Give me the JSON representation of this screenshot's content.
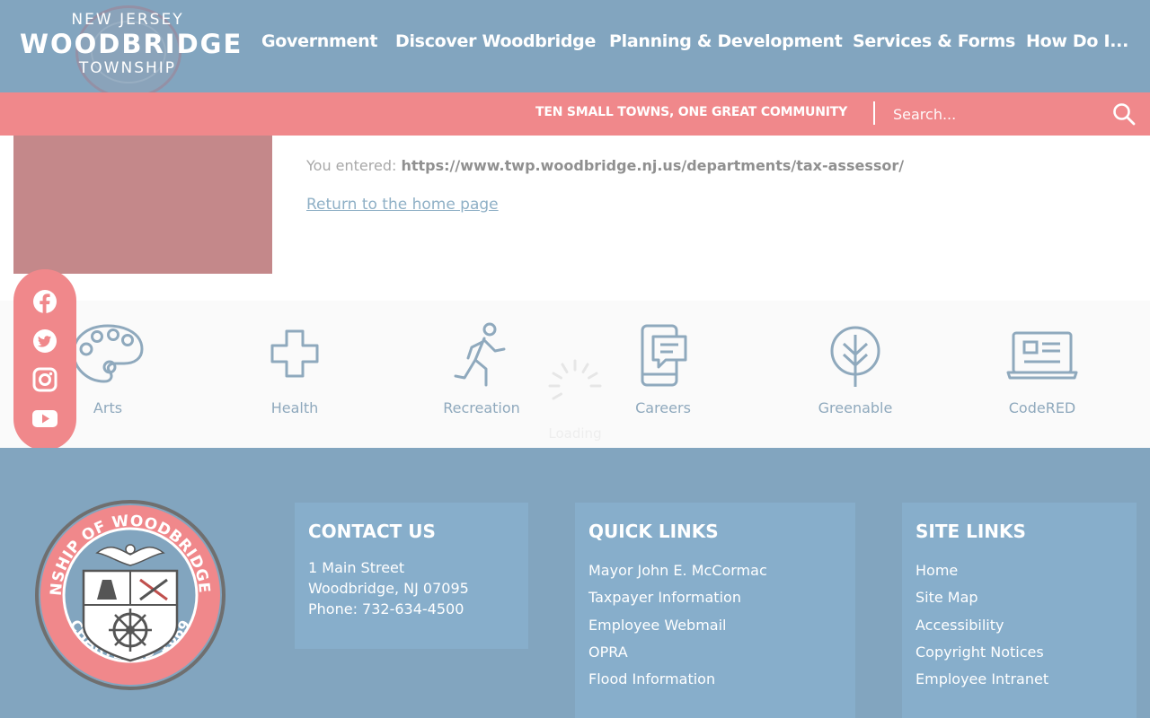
{
  "header": {
    "logo_top": "NEW JERSEY",
    "logo_main": "WOODBRIDGE",
    "logo_bottom": "TOWNSHIP",
    "nav": [
      {
        "label": "Government"
      },
      {
        "label": "Discover Woodbridge"
      },
      {
        "label": "Planning & Development"
      },
      {
        "label": "Services & Forms"
      },
      {
        "label": "How Do I..."
      }
    ]
  },
  "banner": {
    "tagline": "TEN SMALL TOWNS, ONE GREAT COMMUNITY",
    "search_placeholder": "Search...",
    "search_icon": "search-icon"
  },
  "content": {
    "entered_prefix": "You entered:",
    "entered_url": "https://www.twp.woodbridge.nj.us/departments/tax-assessor/",
    "return_link": "Return to the home page"
  },
  "icon_strip": {
    "items": [
      {
        "label": "Arts",
        "icon": "palette-icon"
      },
      {
        "label": "Health",
        "icon": "cross-icon"
      },
      {
        "label": "Recreation",
        "icon": "runner-icon"
      },
      {
        "label": "Careers",
        "icon": "phone-chat-icon"
      },
      {
        "label": "Greenable",
        "icon": "leaf-icon"
      },
      {
        "label": "CodeRED",
        "icon": "laptop-icon"
      }
    ],
    "loading_text": "Loading"
  },
  "social": [
    "facebook-icon",
    "twitter-icon",
    "instagram-icon",
    "youtube-icon"
  ],
  "footer": {
    "seal_text_top": "TOWNSHIP OF WOODBRIDGE, N.J.",
    "seal_text_bottom": "CHARTERED 1669",
    "contact": {
      "title": "CONTACT US",
      "address1": "1 Main Street",
      "address2": "Woodbridge, NJ 07095",
      "phone": "Phone: 732-634-4500"
    },
    "quick_links": {
      "title": "QUICK LINKS",
      "links": [
        "Mayor John E. McCormac",
        "Taxpayer Information",
        "Employee Webmail",
        "OPRA",
        "Flood Information"
      ]
    },
    "site_links": {
      "title": "SITE LINKS",
      "links": [
        "Home",
        "Site Map",
        "Accessibility",
        "Copyright Notices",
        "Employee Intranet"
      ]
    }
  },
  "colors": {
    "header_blue": "#82a5bf",
    "banner_red": "#f0888b",
    "panel_blue": "#87aecb",
    "icon_gray_blue": "#8fa9bd"
  }
}
